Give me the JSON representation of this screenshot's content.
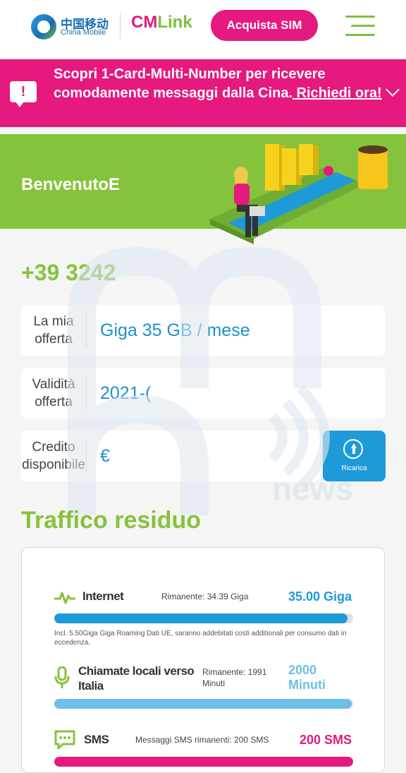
{
  "header": {
    "china_mobile_cn": "中国移动",
    "china_mobile_en": "China Mobile",
    "cmlink_cm": "CM",
    "cmlink_link": "Link",
    "buy_sim_label": "Acquista SIM"
  },
  "promo": {
    "text": "Scopri 1-Card-Multi-Number per ricevere comodamente messaggi dalla Cina.",
    "link": " Richiedi ora!",
    "icon": "alert-bubble-icon"
  },
  "welcome": {
    "title": "BenvenutoE"
  },
  "account": {
    "phone": "+39 3242",
    "offer_label": "La mia offerta",
    "offer_value": "Giga 35 GB / mese",
    "validity_label": "Validità offerta",
    "validity_value": "2021-(",
    "credit_label": "Credito disponibile",
    "credit_value": "€",
    "recharge_label": "Ricarica"
  },
  "traffic": {
    "title": "Traffico residuo",
    "rows": [
      {
        "name": "Internet",
        "remaining": "Rimanente: 34.39 Giga",
        "total": "35.00 Giga",
        "fraction": 0.982,
        "color": "#1e9ad9",
        "icon": "pulse-icon",
        "note": "Incl. 5.50Giga Giga Roaming Dati UE, saranno addebitati costi additionali per consumo dati in eccedenza."
      },
      {
        "name": "Chiamate locali verso Italia",
        "remaining": "Rimanente: 1991 Minuti",
        "total": "2000 Minuti",
        "fraction": 0.995,
        "color": "#6ec0ea",
        "icon": "microphone-icon"
      },
      {
        "name": "SMS",
        "remaining": "Messaggi SMS rimanenti: 200 SMS",
        "total": "200 SMS",
        "fraction": 1.0,
        "color": "#e5197e",
        "icon": "message-icon"
      }
    ]
  },
  "colors": {
    "brand_pink": "#e5197e",
    "brand_green": "#86c33c",
    "brand_blue": "#1e9ad9"
  }
}
